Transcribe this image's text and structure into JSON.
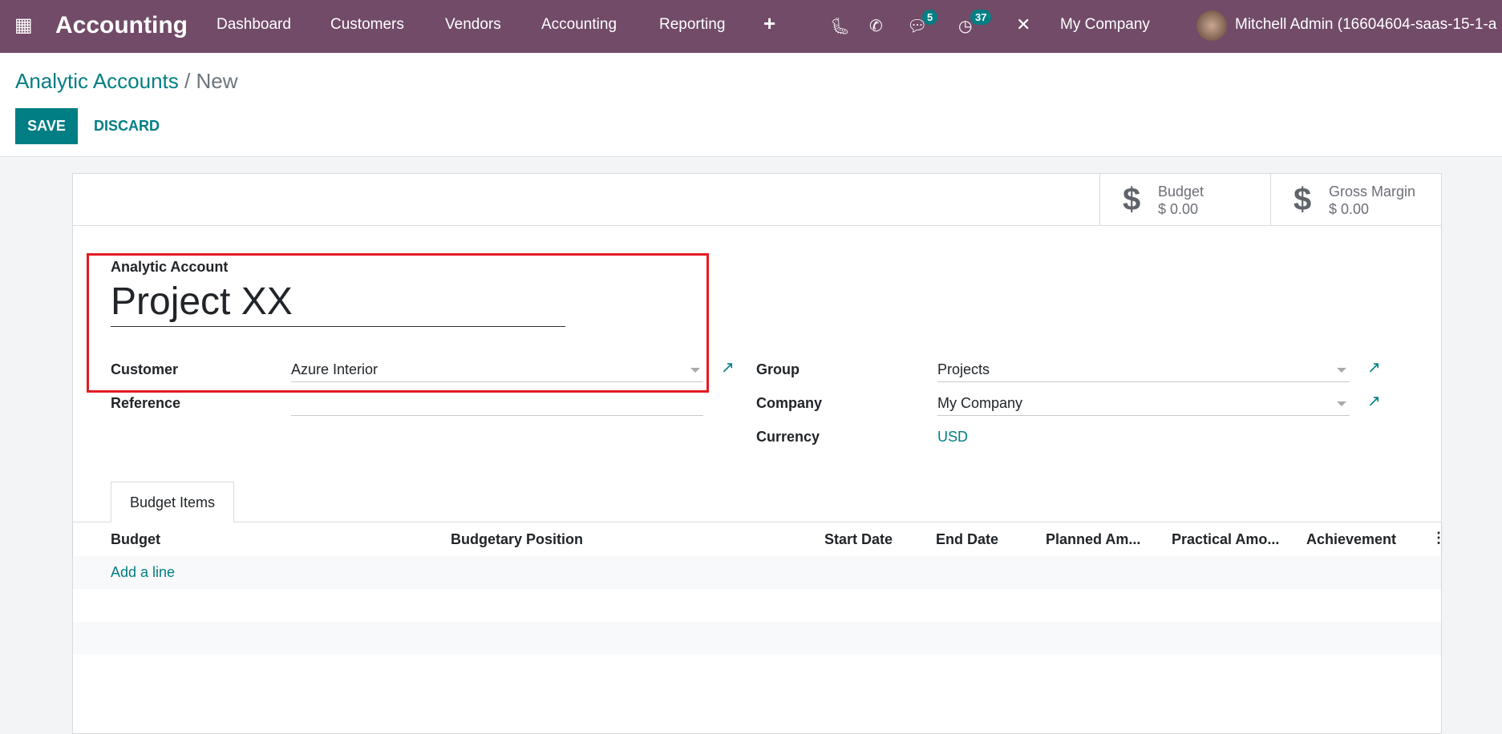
{
  "navbar": {
    "app_title": "Accounting",
    "menu": [
      "Dashboard",
      "Customers",
      "Vendors",
      "Accounting",
      "Reporting"
    ],
    "plus": "+",
    "messages_count": "5",
    "activities_count": "37",
    "company": "My Company",
    "user": "Mitchell Admin (16604604-saas-15-1-a",
    "color": "#714B67"
  },
  "breadcrumb": {
    "parent": "Analytic Accounts",
    "sep": " / ",
    "current": "New"
  },
  "actions": {
    "save": "SAVE",
    "discard": "DISCARD"
  },
  "stats": [
    {
      "label": "Budget",
      "value": "$ 0.00"
    },
    {
      "label": "Gross Margin",
      "value": "$ 0.00"
    }
  ],
  "form": {
    "name_label": "Analytic Account",
    "name": "Project XX",
    "customer_label": "Customer",
    "customer": "Azure Interior",
    "reference_label": "Reference",
    "reference": "",
    "group_label": "Group",
    "group": "Projects",
    "company_label": "Company",
    "company": "My Company",
    "currency_label": "Currency",
    "currency": "USD"
  },
  "tabs": [
    "Budget Items"
  ],
  "table": {
    "columns": [
      "Budget",
      "Budgetary Position",
      "Start Date",
      "End Date",
      "Planned Am...",
      "Practical Amo...",
      "Achievement"
    ],
    "add_line": "Add a line"
  },
  "accent": "#017E84",
  "highlight": "#e31b23"
}
